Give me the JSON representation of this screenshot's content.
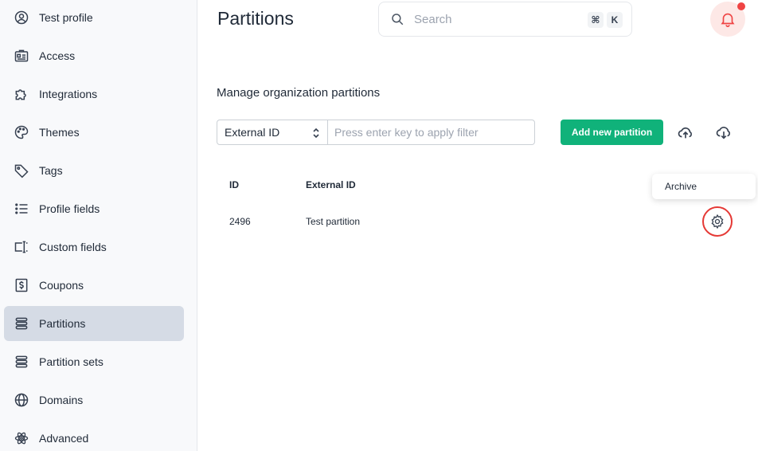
{
  "sidebar": {
    "items": [
      {
        "label": "Test profile",
        "icon": "user-circle-icon",
        "active": false
      },
      {
        "label": "Access",
        "icon": "id-card-icon",
        "active": false
      },
      {
        "label": "Integrations",
        "icon": "puzzle-icon",
        "active": false
      },
      {
        "label": "Themes",
        "icon": "palette-icon",
        "active": false
      },
      {
        "label": "Tags",
        "icon": "tag-icon",
        "active": false
      },
      {
        "label": "Profile fields",
        "icon": "list-icon",
        "active": false
      },
      {
        "label": "Custom fields",
        "icon": "text-cursor-icon",
        "active": false
      },
      {
        "label": "Coupons",
        "icon": "dollar-icon",
        "active": false
      },
      {
        "label": "Partitions",
        "icon": "stack-icon",
        "active": true
      },
      {
        "label": "Partition sets",
        "icon": "stack-icon",
        "active": false
      },
      {
        "label": "Domains",
        "icon": "globe-icon",
        "active": false
      },
      {
        "label": "Advanced",
        "icon": "atom-icon",
        "active": false
      }
    ]
  },
  "header": {
    "title": "Partitions",
    "search_placeholder": "Search",
    "shortcut_key1": "⌘",
    "shortcut_key2": "K"
  },
  "main": {
    "subtitle": "Manage organization partitions",
    "filter": {
      "selected": "External ID",
      "placeholder": "Press enter key to apply filter"
    },
    "add_button": "Add new partition",
    "table": {
      "columns": [
        "ID",
        "External ID"
      ],
      "rows": [
        {
          "id": "2496",
          "external_id": "Test partition"
        }
      ]
    },
    "row_menu": {
      "items": [
        "Archive"
      ]
    }
  },
  "colors": {
    "accent": "#10b27a",
    "alert": "#ef4444",
    "active_nav": "#d5dbe5"
  }
}
